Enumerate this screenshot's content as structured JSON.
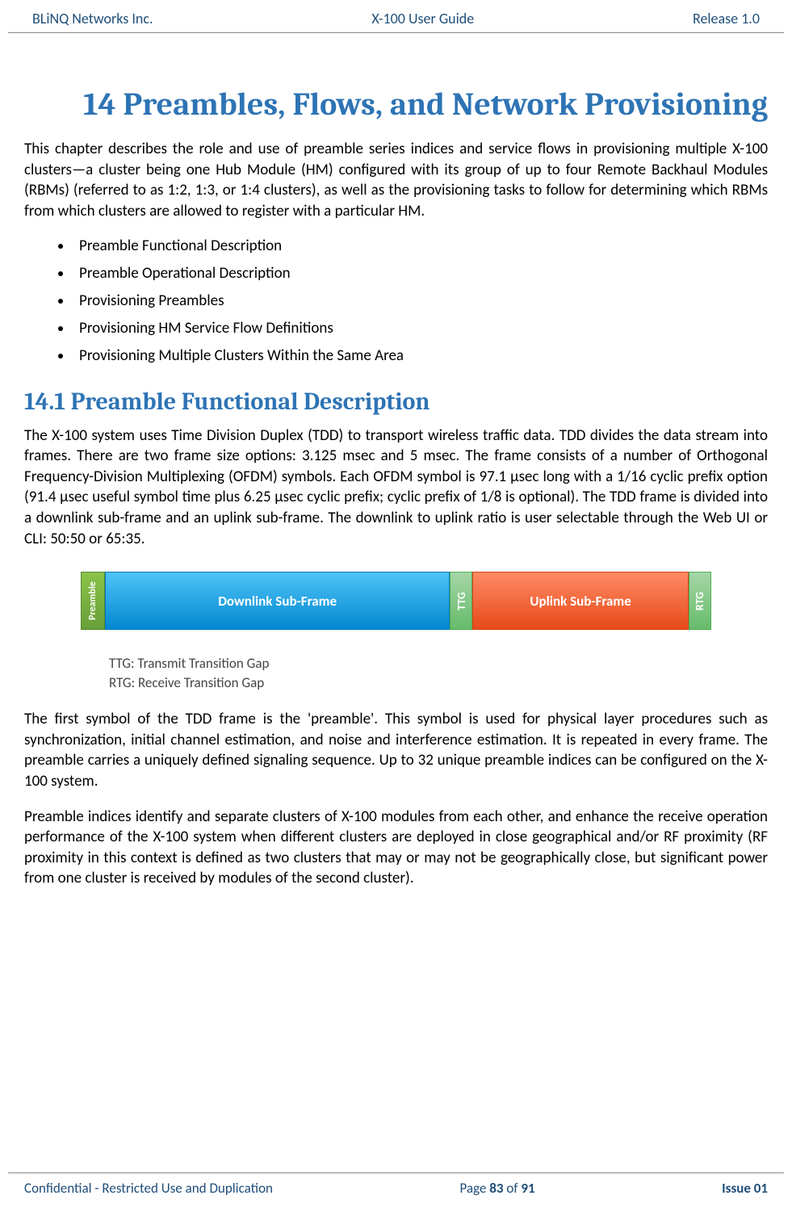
{
  "header": {
    "left": "BLiNQ Networks Inc.",
    "center": "X-100 User Guide",
    "right": "Release 1.0"
  },
  "title": "14 Preambles, Flows, and Network Provisioning",
  "intro": "This chapter describes the role and use of preamble series indices and service flows in provisioning multiple X-100 clusters—a cluster being one Hub Module (HM) configured with its group of up to four Remote Backhaul Modules (RBMs) (referred to as 1:2, 1:3, or 1:4 clusters), as well as the provisioning tasks to follow for determining which RBMs from which clusters are allowed to register with a particular HM.",
  "bullets": [
    "Preamble Functional Description",
    "Preamble Operational Description",
    "Provisioning Preambles",
    "Provisioning HM Service Flow Definitions",
    "Provisioning Multiple Clusters Within the Same Area"
  ],
  "section_title": "14.1 Preamble Functional Description",
  "para1": "The X-100 system uses Time Division Duplex (TDD) to transport wireless traffic data. TDD divides the data stream into frames. There are two frame size options: 3.125 msec and 5 msec. The frame consists of a number of Orthogonal Frequency-Division Multiplexing (OFDM) symbols. Each OFDM symbol is 97.1 μsec long with a 1/16 cyclic prefix option (91.4 μsec useful symbol time plus 6.25 μsec cyclic prefix; cyclic prefix of 1/8 is optional). The TDD frame is divided into a downlink sub-frame and an uplink sub-frame. The downlink to uplink ratio is user selectable through the Web UI or CLI: 50:50 or 65:35.",
  "diagram": {
    "preamble": "Preamble",
    "downlink": "Downlink Sub-Frame",
    "ttg": "TTG",
    "uplink": "Uplink Sub-Frame",
    "rtg": "RTG",
    "legend_ttg": "TTG: Transmit Transition Gap",
    "legend_rtg": "RTG: Receive Transition Gap"
  },
  "para2": "The first symbol of the TDD frame is the 'preamble'. This symbol is used for physical layer procedures such as synchronization, initial channel estimation, and noise and interference estimation. It is repeated in every frame. The preamble carries a uniquely defined signaling sequence. Up to 32 unique preamble indices can be configured on the X-100 system.",
  "para3": "Preamble indices identify and separate clusters of X-100 modules from each other, and enhance the receive operation performance of the X-100 system when different clusters are deployed in close geographical and/or RF proximity (RF proximity in this context is defined as two clusters that may or may not be geographically close, but significant power from one cluster is received by modules of the second cluster).",
  "footer": {
    "left": "Confidential - Restricted Use and Duplication",
    "page_prefix": "Page ",
    "page_current": "83",
    "page_sep": " of ",
    "page_total": "91",
    "issue": "Issue 01"
  }
}
